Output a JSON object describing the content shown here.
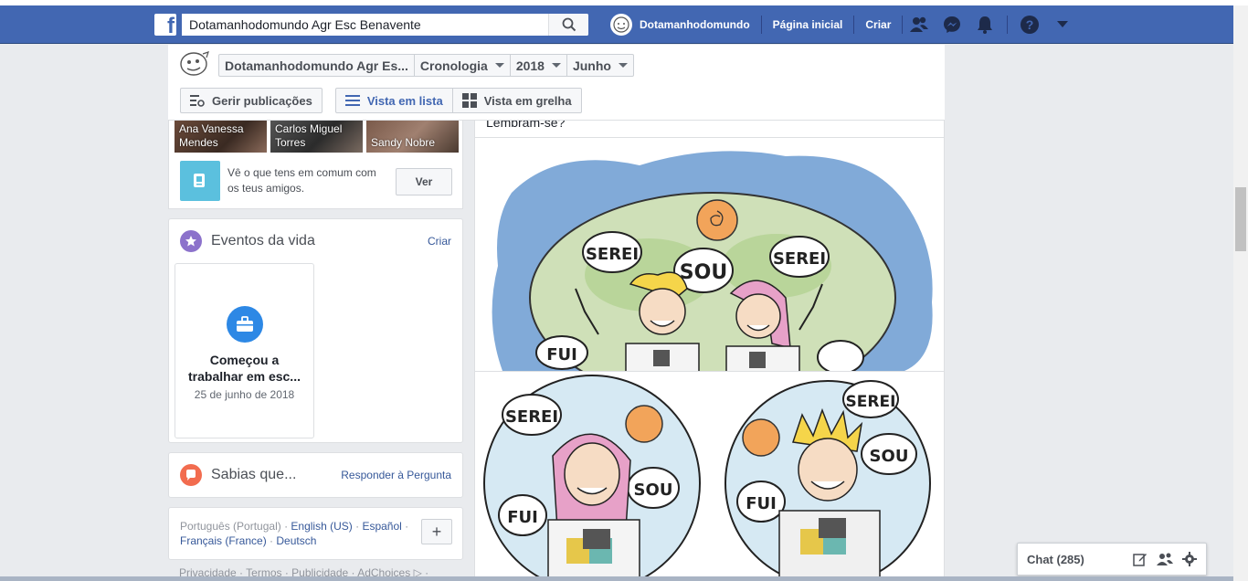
{
  "topbar": {
    "logo_letter": "f",
    "search_value": "Dotamanhodomundo Agr Esc Benavente",
    "user_name": "Dotamanhodomundo",
    "home_label": "Página inicial",
    "create_label": "Criar"
  },
  "timeline": {
    "crumbs": [
      "Dotamanhodomundo Agr Es...",
      "Cronologia",
      "2018",
      "Junho"
    ],
    "manage_label": "Gerir publicações",
    "list_view_label": "Vista em lista",
    "grid_view_label": "Vista em grelha"
  },
  "friends": {
    "names": [
      "Ana Vanessa Mendes",
      "Carlos Miguel Torres",
      "Sandy Nobre"
    ],
    "common_text": "Vê o que tens em comum com os teus amigos.",
    "ver_label": "Ver"
  },
  "life_events": {
    "title": "Eventos da vida",
    "action": "Criar",
    "event_title": "Começou a trabalhar em esc...",
    "event_date": "25 de junho de 2018"
  },
  "ask": {
    "title": "Sabias que...",
    "action": "Responder à Pergunta"
  },
  "languages": {
    "current": "Português (Portugal)",
    "others": [
      "English (US)",
      "Español",
      "Français (France)",
      "Deutsch"
    ],
    "plus": "+"
  },
  "footer": {
    "links": "Privacidade · Termos · Publicidade · AdChoices ▷ ·"
  },
  "post": {
    "caption": "Lembram-se?",
    "bubble_main": [
      "SEREI",
      "SOU",
      "SEREI",
      "FUI"
    ],
    "bubble_left": [
      "SEREI",
      "SOU",
      "FUI"
    ],
    "bubble_right": [
      "SEREI",
      "SOU",
      "FUI"
    ]
  },
  "chat": {
    "label": "Chat (285)"
  },
  "colors": {
    "brand_blue": "#4267b2",
    "link_blue": "#365899"
  }
}
